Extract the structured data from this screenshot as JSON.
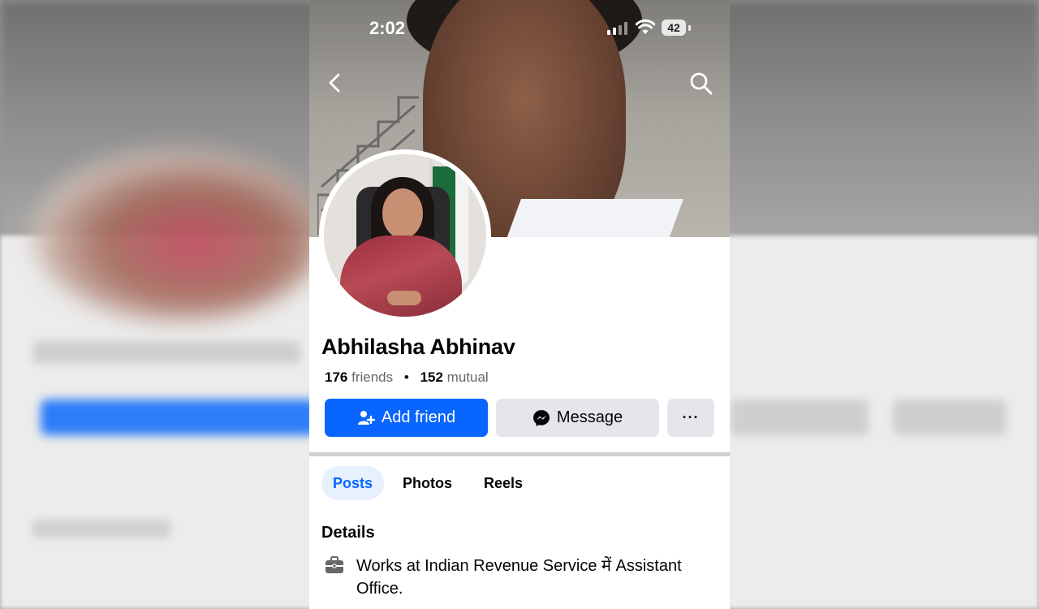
{
  "status_bar": {
    "time": "2:02",
    "battery": "42"
  },
  "profile": {
    "name": "Abhilasha Abhinav",
    "friends_count": "176",
    "friends_label": "friends",
    "separator": "•",
    "mutual_count": "152",
    "mutual_label": "mutual"
  },
  "actions": {
    "add_friend_label": "Add friend",
    "message_label": "Message",
    "more_label": "···"
  },
  "tabs": [
    {
      "label": "Posts",
      "active": true
    },
    {
      "label": "Photos",
      "active": false
    },
    {
      "label": "Reels",
      "active": false
    }
  ],
  "details": {
    "title": "Details",
    "work_line1": "Works at Indian Revenue Service में Assistant",
    "work_line2": "Office."
  },
  "icons": {
    "back": "chevron-left-icon",
    "search": "search-icon",
    "add_friend": "add-person-icon",
    "message": "messenger-icon",
    "work": "briefcase-icon"
  },
  "colors": {
    "accent": "#0866ff",
    "secondary_button": "#e4e6eb",
    "active_tab_bg": "#e7f0fd"
  }
}
